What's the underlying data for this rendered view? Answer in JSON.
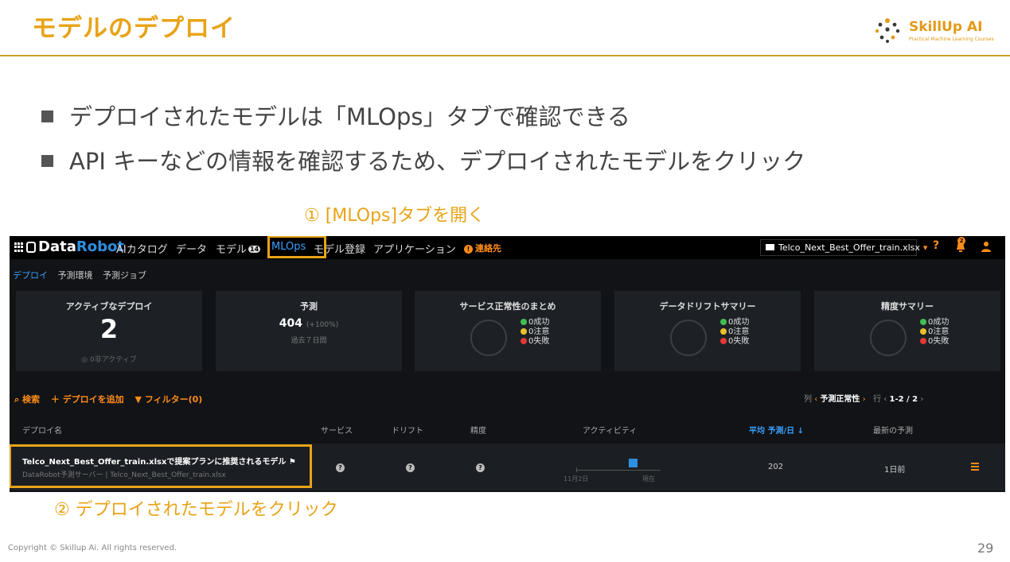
{
  "slide": {
    "title": "モデルのデプロイ",
    "bullets": [
      "デプロイされたモデルは「MLOps」タブで確認できる",
      "API キーなどの情報を確認するため、デプロイされたモデルをクリック"
    ],
    "callout_1": "① [MLOps]タブを開く",
    "callout_2": "② デプロイされたモデルをクリック",
    "copyright": "Copyright © Skillup Ai. All rights reserved.",
    "page_number": "29",
    "accent_color": "#e8a317"
  },
  "logo": {
    "name": "SkillUp AI",
    "tagline": "Practical Machine Learning Courses"
  },
  "app": {
    "brand_part1": "Data",
    "brand_part2": "Robot",
    "nav": [
      "AIカタログ",
      "データ",
      "モデル",
      "MLOps",
      "モデル登録",
      "アプリケーション"
    ],
    "nav_badge": "14",
    "contact": "連絡先",
    "file_selector": "Telco_Next_Best_Offer_train.xlsx",
    "notification_count": "2",
    "subtabs": [
      "デプロイ",
      "予測環境",
      "予測ジョブ"
    ],
    "cards": {
      "active": {
        "title": "アクティブなデプロイ",
        "value": "2",
        "sub": "0非アクティブ"
      },
      "predictions": {
        "title": "予測",
        "value": "404",
        "delta": "(+100%)",
        "sub": "過去７日間"
      },
      "service": {
        "title": "サービス正常性のまとめ",
        "ok": "0成功",
        "warn": "0注意",
        "fail": "0失敗"
      },
      "drift": {
        "title": "データドリフトサマリー",
        "ok": "0成功",
        "warn": "0注意",
        "fail": "0失敗"
      },
      "accuracy": {
        "title": "精度サマリー",
        "ok": "0成功",
        "warn": "0注意",
        "fail": "0失敗"
      }
    },
    "toolbar": {
      "search": "検索",
      "add": "デプロイを追加",
      "filter": "フィルター(0)",
      "col_label": "列",
      "col_value": "予測正常性",
      "row_label": "行",
      "range": "1-2 / 2"
    },
    "table": {
      "headers": [
        "デプロイ名",
        "サービス",
        "ドリフト",
        "精度",
        "アクティビティ",
        "平均 予測/日",
        "最新の予測"
      ],
      "row": {
        "name": "Telco_Next_Best_Offer_train.xlsxで提案プランに推奨されるモデル",
        "sub": "DataRobot予測サーバー | Telco_Next_Best_Offer_train.xlsx",
        "activity_start": "11月2日",
        "activity_end": "現在",
        "avg_per_day": "202",
        "latest": "1日前"
      }
    },
    "status_colors": {
      "ok": "#3fbf4f",
      "warn": "#e8c22a",
      "fail": "#e53935"
    }
  }
}
